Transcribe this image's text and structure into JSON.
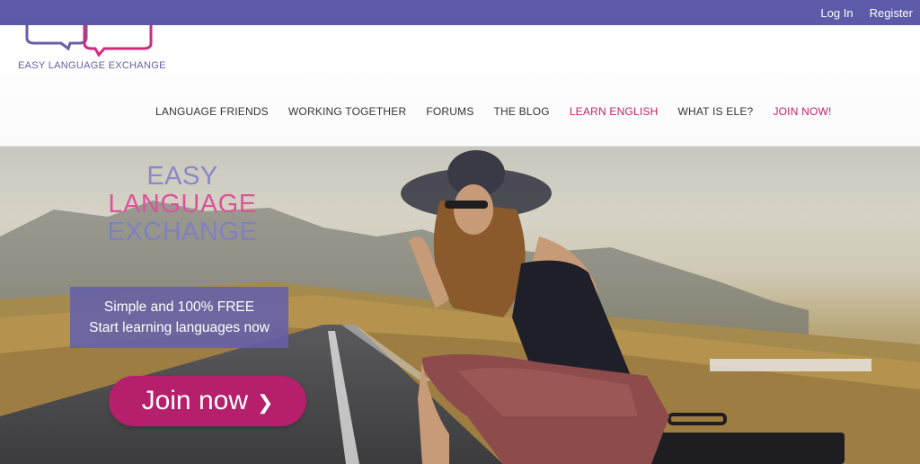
{
  "topbar": {
    "login": "Log In",
    "register": "Register",
    "bg_color": "#5b5ba8"
  },
  "logo": {
    "text": "EASY LANGUAGE EXCHANGE",
    "icon": "speech-bubbles-logo"
  },
  "nav": {
    "items": [
      {
        "label": "LANGUAGE FRIENDS"
      },
      {
        "label": "WORKING TOGETHER"
      },
      {
        "label": "FORUMS"
      },
      {
        "label": "THE BLOG"
      },
      {
        "label": "LEARN ENGLISH",
        "accent": true
      },
      {
        "label": "WHAT IS ELE?"
      },
      {
        "label": "JOIN NOW!",
        "accent": true
      }
    ],
    "accent_color": "#c2226e"
  },
  "hero": {
    "brand": {
      "line1": "EASY",
      "line2": "LANGUAGE",
      "line3": "EXCHANGE"
    },
    "tagline": {
      "line1": "Simple and 100% FREE",
      "line2": "Start learning languages now"
    },
    "cta": {
      "label": "Join now",
      "icon": "chevron-right-icon",
      "color": "#b51f6c"
    }
  }
}
